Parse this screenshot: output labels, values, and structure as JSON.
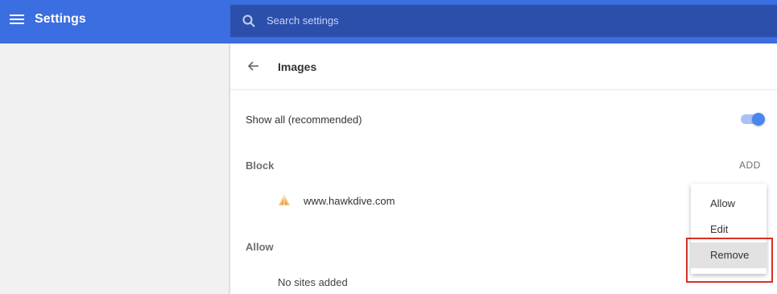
{
  "header": {
    "app_title": "Settings",
    "menu_icon": "hamburger-menu-icon"
  },
  "search": {
    "placeholder": "Search settings",
    "icon": "search-icon"
  },
  "page": {
    "title": "Images",
    "back_icon": "arrow-left-icon"
  },
  "show_all": {
    "label": "Show all (recommended)",
    "enabled": true
  },
  "block_section": {
    "label": "Block",
    "add_label": "ADD",
    "sites": [
      {
        "name": "www.hawkdive.com",
        "favicon": "hawkdive-favicon-icon"
      }
    ]
  },
  "allow_section": {
    "label": "Allow",
    "empty_text": "No sites added"
  },
  "context_menu": {
    "items": [
      {
        "label": "Allow"
      },
      {
        "label": "Edit"
      },
      {
        "label": "Remove",
        "highlighted": true
      }
    ]
  },
  "colors": {
    "header": "#3b6ee0",
    "search_box": "#2d4fac",
    "toggle_on": "#4a86f0",
    "highlight_border": "#d93025"
  }
}
